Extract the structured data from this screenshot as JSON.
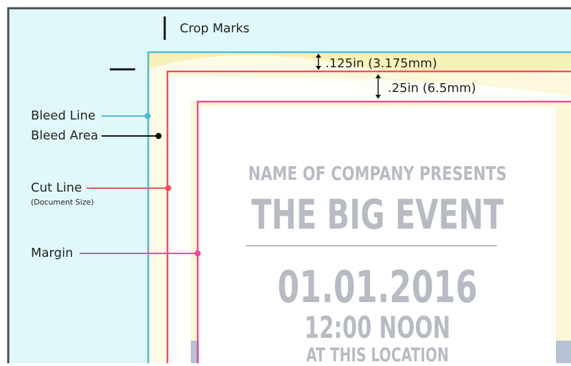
{
  "annotations": {
    "crop_marks": "Crop Marks",
    "bleed_dimension": ".125in (3.175mm)",
    "margin_dimension": ".25in (6.5mm)",
    "bleed_line": "Bleed Line",
    "bleed_area": "Bleed Area",
    "cut_line": "Cut Line",
    "cut_line_note": "(Document Size)",
    "margin": "Margin"
  },
  "flyer": {
    "presenter": "NAME OF COMPANY PRESENTS",
    "event_title": "THE BIG EVENT",
    "date": "01.01.2016",
    "time": "12:00 NOON",
    "location": "AT THIS LOCATION"
  },
  "colors": {
    "bleed_line": "#4bb8d9",
    "cut_line": "#f0505a",
    "margin": "#e64a9c",
    "bleed_area_fill": "#e1f8fb",
    "swoosh": "#f7f1b8",
    "flyer_text": "#b7bcc4",
    "frame": "#4a4a4a"
  }
}
